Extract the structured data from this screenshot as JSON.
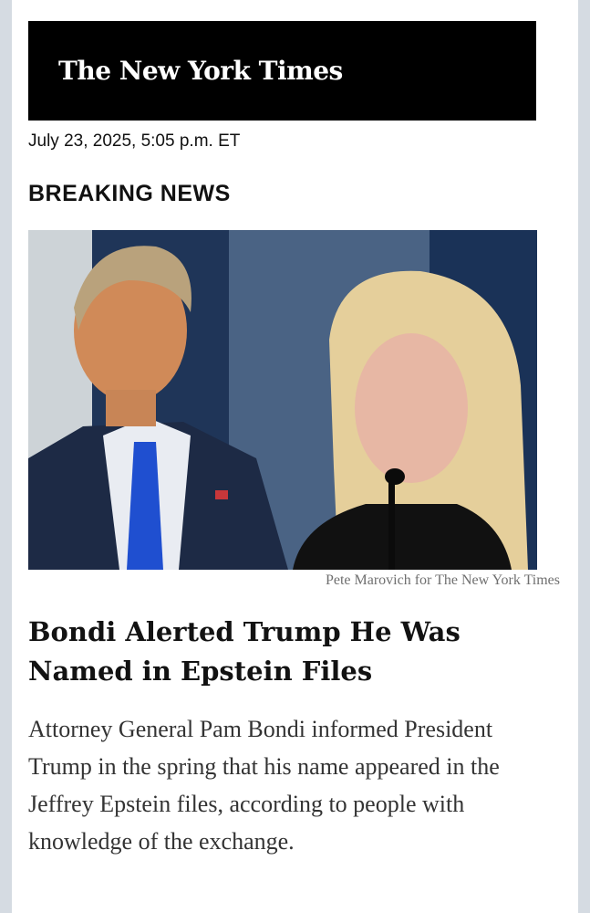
{
  "masthead": {
    "logo_text": "The New York Times"
  },
  "dateline": "July 23, 2025, 5:05 p.m. ET",
  "label": "BREAKING NEWS",
  "photo": {
    "credit": "Pete Marovich for The New York Times"
  },
  "article": {
    "headline": "Bondi Alerted Trump He Was Named in Epstein Files",
    "summary": "Attorney General Pam Bondi informed President Trump in the spring that his name appeared in the Jeffrey Epstein files, according to people with knowledge of the exchange."
  },
  "colors": {
    "masthead_bg": "#000000",
    "background": "#d5dbe2",
    "tie": "#1f4fd0"
  }
}
